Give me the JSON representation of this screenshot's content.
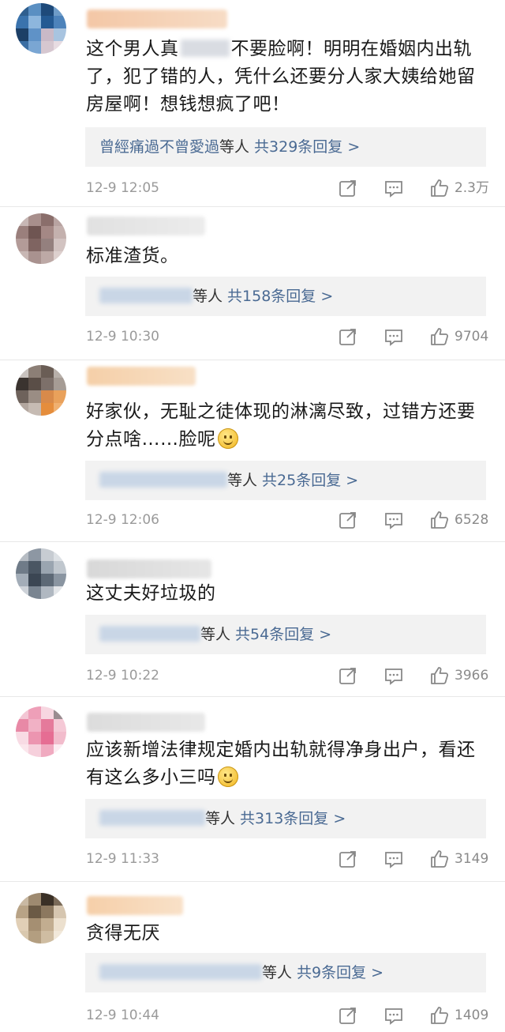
{
  "comments": [
    {
      "text_before": "这个男人真",
      "text_after": "不要脸啊！明明在婚姻内出轨了，犯了错的人，凭什么还要分人家大姨给她留房屋啊！想钱想疯了吧！",
      "reply_first_user": "曾經痛過不曾愛過",
      "reply_others": "等人",
      "reply_count_text": "共329条回复 >",
      "time": "12-9 12:05",
      "likes": "2.3万"
    },
    {
      "text": "标准渣货。",
      "reply_others": "等人",
      "reply_count_text": "共158条回复 >",
      "time": "12-9 10:30",
      "likes": "9704"
    },
    {
      "text": "好家伙，无耻之徒体现的淋漓尽致，过错方还要分点啥……脸呢",
      "emoji": "smile-emoji",
      "reply_others": "等人",
      "reply_count_text": "共25条回复 >",
      "time": "12-9 12:06",
      "likes": "6528"
    },
    {
      "text": "这丈夫好垃圾的",
      "reply_others": "等人",
      "reply_count_text": "共54条回复 >",
      "time": "12-9 10:22",
      "likes": "3966"
    },
    {
      "text": "应该新增法律规定婚内出轨就得净身出户，看还有这么多小三吗",
      "emoji": "smile-emoji",
      "reply_others": "等人",
      "reply_count_text": "共313条回复 >",
      "time": "12-9 11:33",
      "likes": "3149"
    },
    {
      "text": "贪得无厌",
      "reply_others": "等人",
      "reply_count_text": "共9条回复 >",
      "time": "12-9 10:44",
      "likes": "1409"
    }
  ],
  "icons": {
    "share": "share-icon",
    "comment": "comment-icon",
    "like": "thumbs-up-icon"
  },
  "colors": {
    "reply_link": "#4a6a93",
    "reply_bg": "#f2f2f2",
    "meta_text": "#9a9a9a"
  }
}
